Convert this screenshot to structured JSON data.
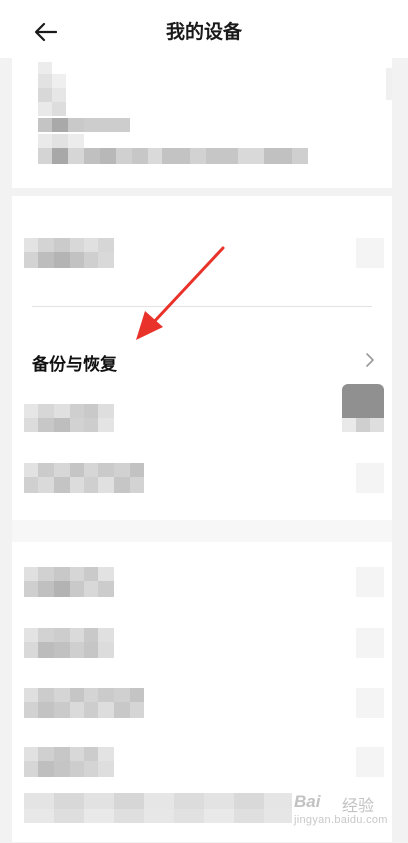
{
  "header": {
    "title": "我的设备",
    "back_icon": "arrow-left-icon"
  },
  "settings": {
    "backup_row_label": "备份与恢复",
    "chevron_icon": "chevron-right-icon"
  },
  "annotation": {
    "arrow_color": "#e8322a"
  },
  "watermark": {
    "logo_text": "Bai",
    "name_text": "经验",
    "url_text": "jingyan.baidu.com"
  }
}
